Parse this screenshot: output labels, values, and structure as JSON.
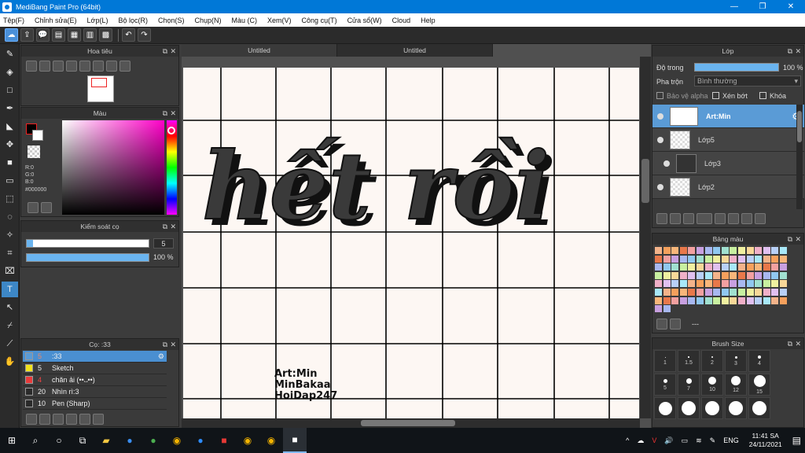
{
  "window": {
    "title": "MediBang Paint Pro (64bit)",
    "min": "—",
    "max": "❐",
    "close": "✕"
  },
  "menu": [
    "Tệp(F)",
    "Chỉnh sửa(E)",
    "Lớp(L)",
    "Bộ lọc(R)",
    "Chọn(S)",
    "Chụp(N)",
    "Màu (C)",
    "Xem(V)",
    "Công cụ(T)",
    "Cửa sổ(W)",
    "Cloud",
    "Help"
  ],
  "toolbar": {
    "undo": "↶",
    "redo": "↷"
  },
  "navigator": {
    "title": "Hoa tiêu"
  },
  "color_panel": {
    "title": "Màu",
    "r": "R:0",
    "g": "G:0",
    "b": "B:0",
    "hex": "#000000",
    "fg": "#000000",
    "bg": "#ffffff"
  },
  "brush_control": {
    "title": "Kiểm soát cọ",
    "size": "5",
    "opacity": "100 %",
    "size_fraction": 0.05,
    "opacity_fraction": 1.0
  },
  "brushes": {
    "title": "Cọ: :33",
    "items": [
      {
        "size": "5",
        "name": ":33",
        "color": "#5a9bd6",
        "selected": true
      },
      {
        "size": "5",
        "name": "Sketch",
        "color": "#f2e21c",
        "selected": false
      },
      {
        "size": "4",
        "name": "chăn ải (••᎑••)",
        "color": "#e83a3a",
        "selected": false
      },
      {
        "size": "20",
        "name": "Nhìn rì:3",
        "color": "#2a2a2a",
        "selected": false
      },
      {
        "size": "10",
        "name": "Pen (Sharp)",
        "color": "#2a2a2a",
        "selected": false
      }
    ]
  },
  "tabs": [
    "Untitled",
    "Untitled"
  ],
  "canvas": {
    "artwork_text": "hết rồi",
    "signature": [
      "Art:Min",
      "MinBakaa",
      "HoiDap247"
    ]
  },
  "layers_panel": {
    "title": "Lớp",
    "opacity_label": "Độ trong",
    "opacity_value": "100 %",
    "blend_label": "Pha trộn",
    "blend_value": "Bình thường",
    "protect_alpha": "Bảo vệ alpha",
    "clipping": "Xén bớt",
    "lock": "Khóa",
    "layers": [
      {
        "name": "Art:Min",
        "selected": true
      },
      {
        "name": "Lớp5",
        "selected": false
      },
      {
        "name": "Lớp3",
        "selected": false
      },
      {
        "name": "Lớp2",
        "selected": false
      }
    ]
  },
  "palette": {
    "title": "Bảng màu",
    "footer": "---"
  },
  "brush_size_panel": {
    "title": "Brush Size",
    "sizes": [
      "1",
      "1.5",
      "2",
      "3",
      "4",
      "5",
      "7",
      "10",
      "12",
      "15",
      "",
      "",
      "",
      "",
      ""
    ]
  },
  "taskbar": {
    "language": "ENG",
    "time": "11:41 SA",
    "date": "24/11/2021"
  }
}
